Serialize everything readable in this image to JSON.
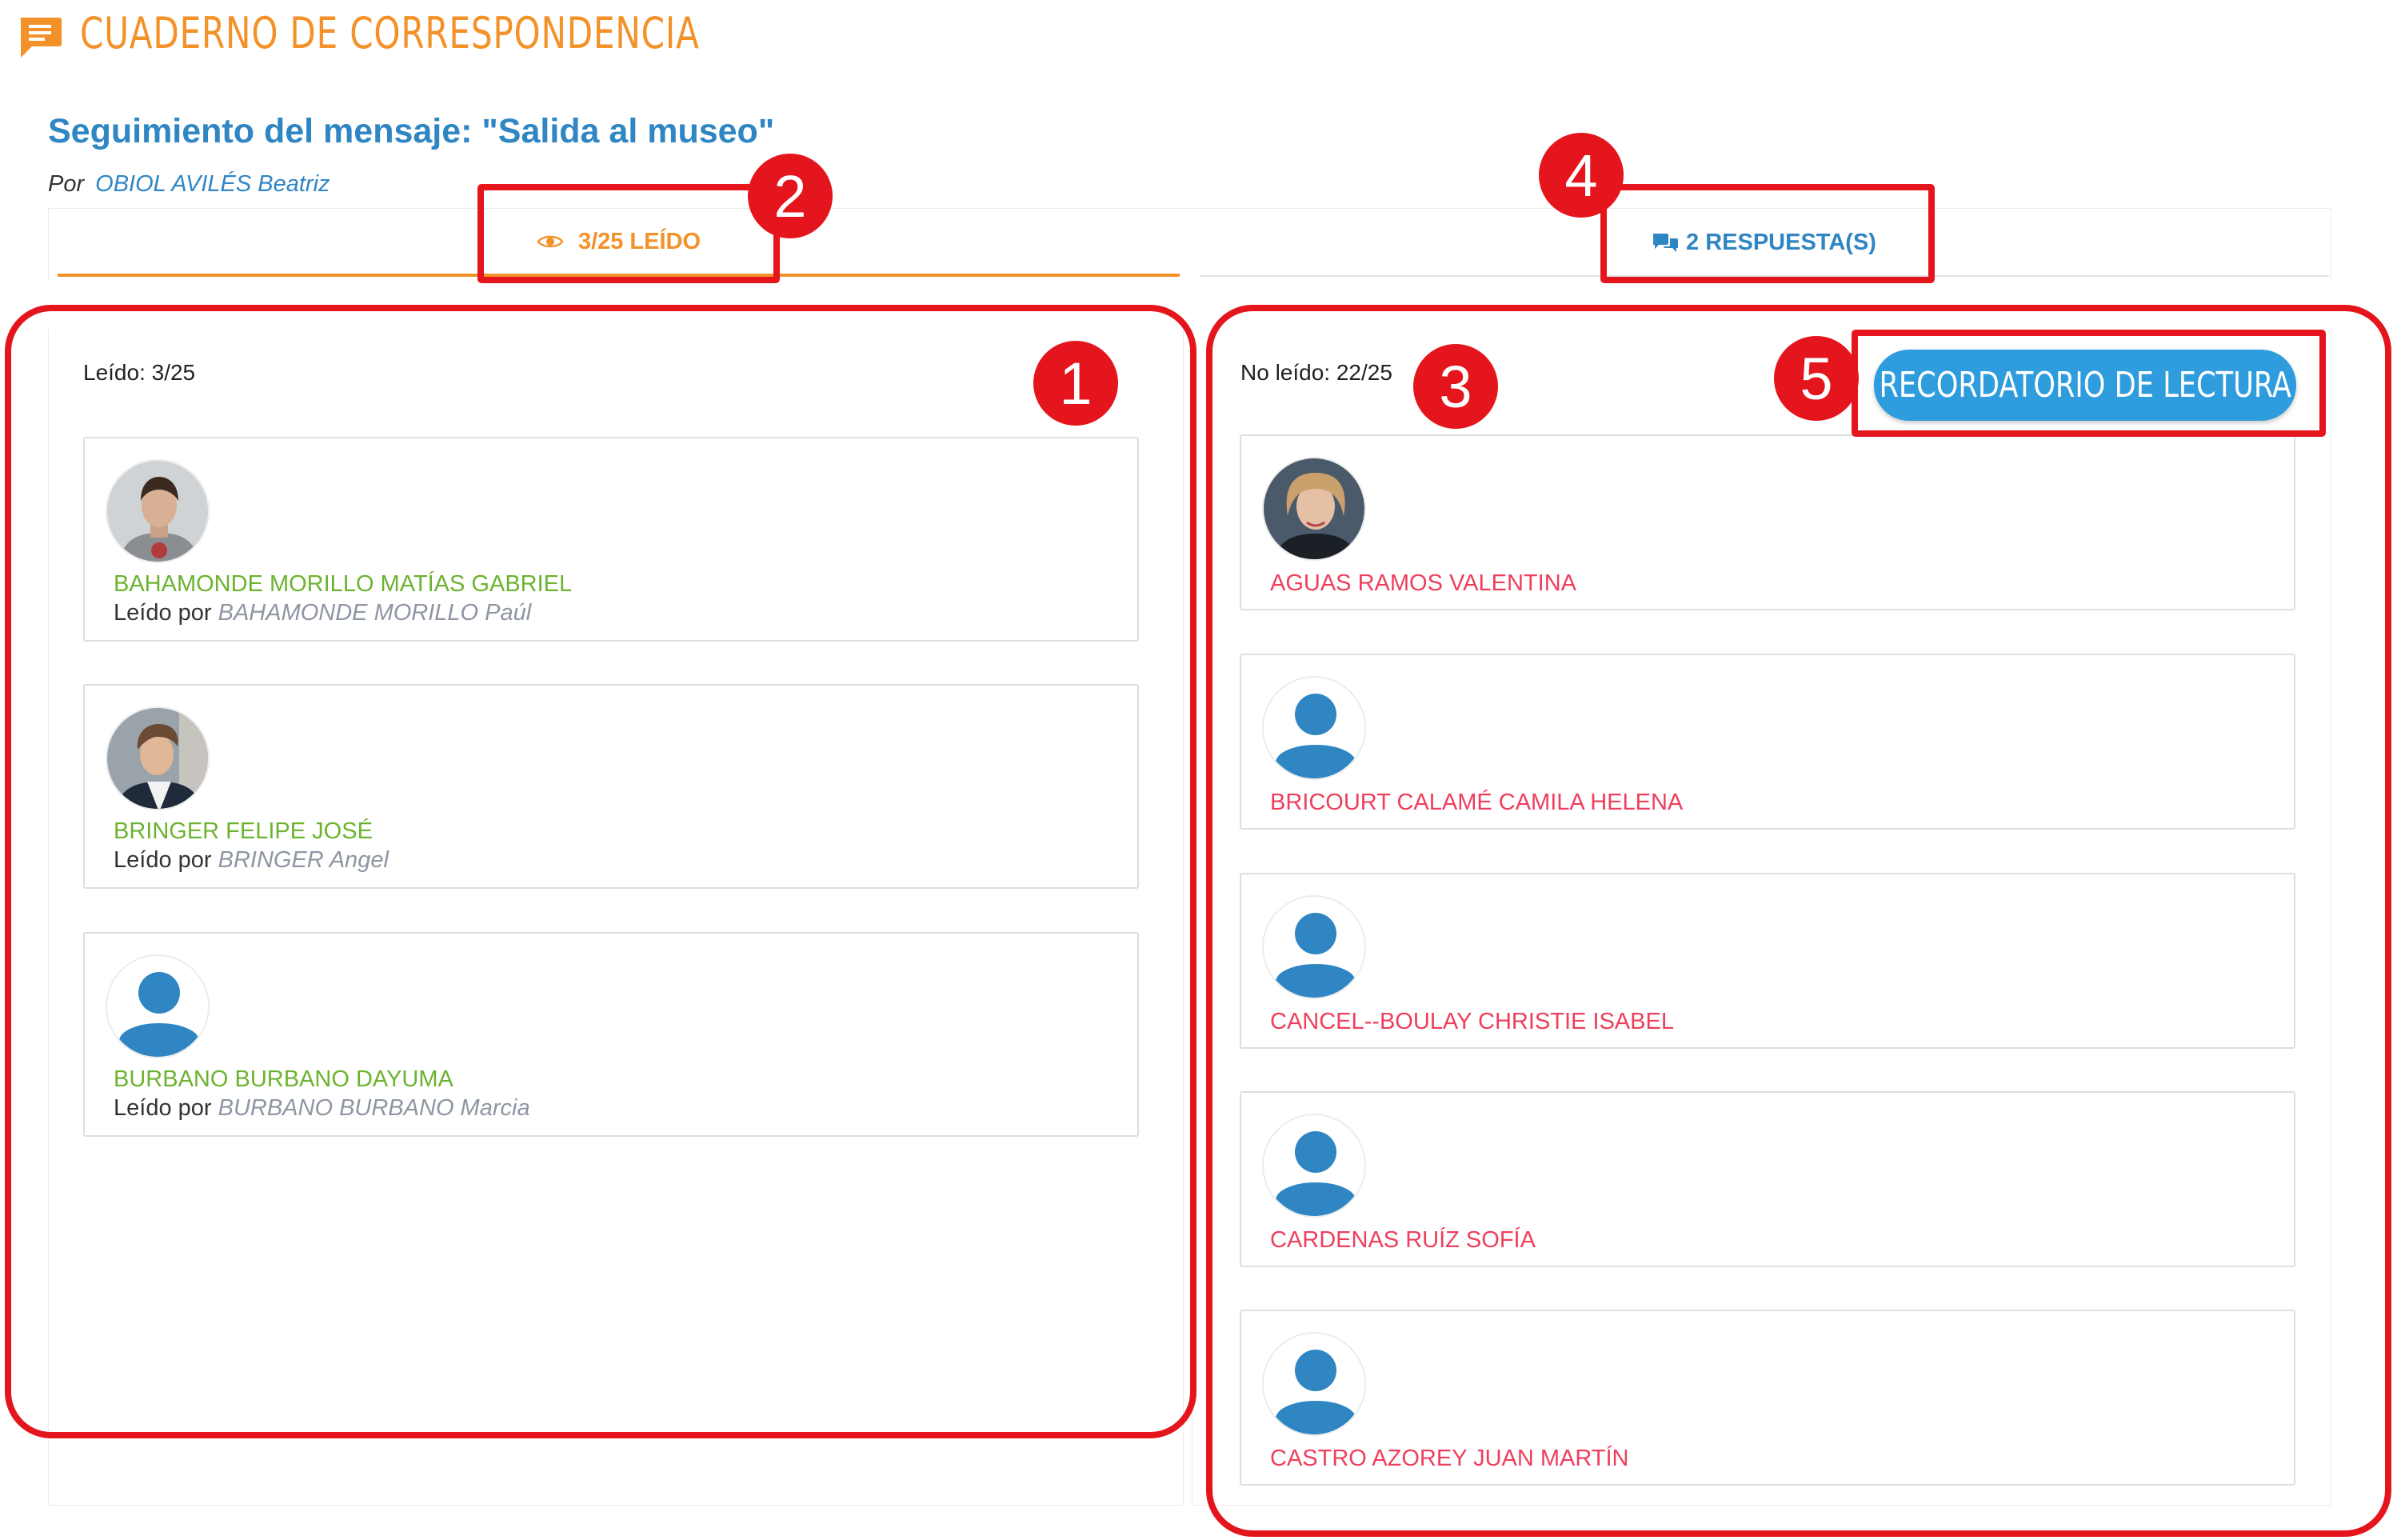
{
  "app": {
    "title": "CUADERNO DE CORRESPONDENCIA"
  },
  "message": {
    "title": "Seguimiento del mensaje: \"Salida al museo\"",
    "author_label": "Por",
    "author": "OBIOL AVILÉS Beatriz"
  },
  "tabs": {
    "read": "3/25 LEÍDO",
    "replies": "2 RESPUESTA(S)"
  },
  "read_panel": {
    "count": "Leído: 3/25",
    "read_by_label": "Leído por",
    "students": [
      {
        "name": "BAHAMONDE MORILLO MATÍAS GABRIEL",
        "reader": "BAHAMONDE MORILLO Paúl",
        "avatar": "photo"
      },
      {
        "name": "BRINGER FELIPE JOSÉ",
        "reader": "BRINGER Angel",
        "avatar": "photo"
      },
      {
        "name": "BURBANO BURBANO DAYUMA",
        "reader": "BURBANO BURBANO Marcia",
        "avatar": "placeholder"
      }
    ]
  },
  "unread_panel": {
    "count": "No leído: 22/25",
    "reminder_button": "RECORDATORIO DE LECTURA",
    "students": [
      {
        "name": "AGUAS RAMOS VALENTINA",
        "avatar": "photo"
      },
      {
        "name": "BRICOURT CALAMÉ CAMILA HELENA",
        "avatar": "placeholder"
      },
      {
        "name": "CANCEL--BOULAY CHRISTIE ISABEL",
        "avatar": "placeholder"
      },
      {
        "name": "CARDENAS RUÍZ SOFÍA",
        "avatar": "placeholder"
      },
      {
        "name": "CASTRO AZOREY JUAN MARTÍN",
        "avatar": "placeholder"
      }
    ]
  },
  "annotations": [
    "1",
    "2",
    "3",
    "4",
    "5"
  ],
  "colors": {
    "orange": "#f39229",
    "blue": "#2f86c3",
    "green": "#6cb32f",
    "red": "#ee3f5d",
    "highlight": "#e4151c",
    "button": "#2f9cdd"
  },
  "icons": {
    "header": "chat-bubble-icon",
    "read_tab": "eye-icon",
    "replies_tab": "chat-bubbles-icon",
    "avatar_placeholder": "user-silhouette-icon"
  }
}
